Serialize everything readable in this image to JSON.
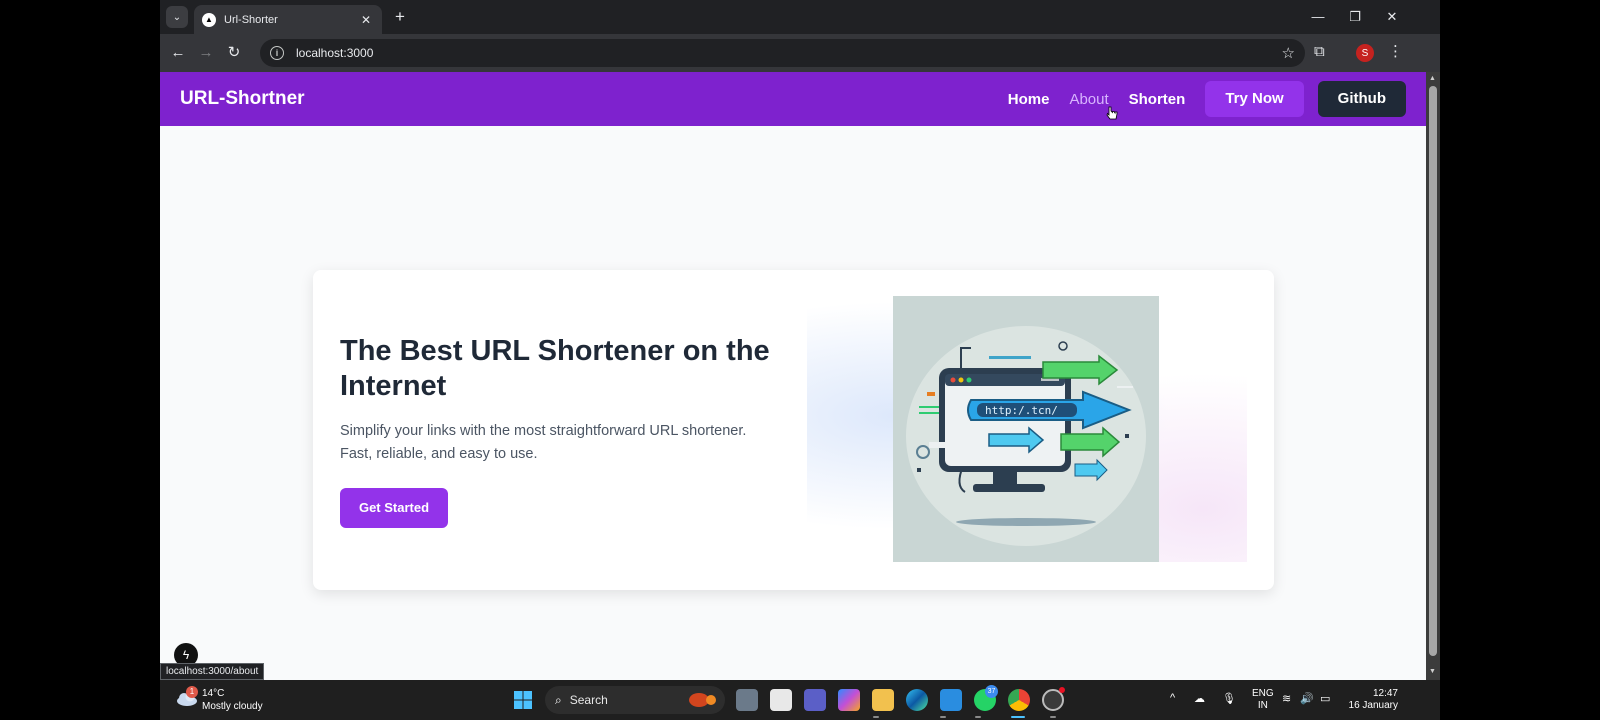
{
  "browser": {
    "tab_title": "Url-Shorter",
    "new_tab_label": "+",
    "url": "localhost:3000",
    "status_url": "localhost:3000/about",
    "profile_initial": "S"
  },
  "site": {
    "brand": "URL-Shortner",
    "nav": {
      "home": "Home",
      "about": "About",
      "shorten": "Shorten",
      "try_now": "Try Now",
      "github": "Github"
    },
    "hero": {
      "title": "The Best URL Shortener on the Internet",
      "subtitle": "Simplify your links with the most straightforward URL shortener. Fast, reliable, and easy to use.",
      "cta": "Get Started",
      "illustration_url_text": "http:/.tcn/"
    },
    "colors": {
      "nav_bg": "#7e22ce",
      "accent": "#9333ea",
      "github_bg": "#1f2937"
    }
  },
  "taskbar": {
    "weather_temp": "14°C",
    "weather_desc": "Mostly cloudy",
    "weather_badge": "1",
    "search_label": "Search",
    "whatsapp_badge": "37",
    "lang_line1": "ENG",
    "lang_line2": "IN",
    "time": "12:47",
    "date": "16 January"
  }
}
